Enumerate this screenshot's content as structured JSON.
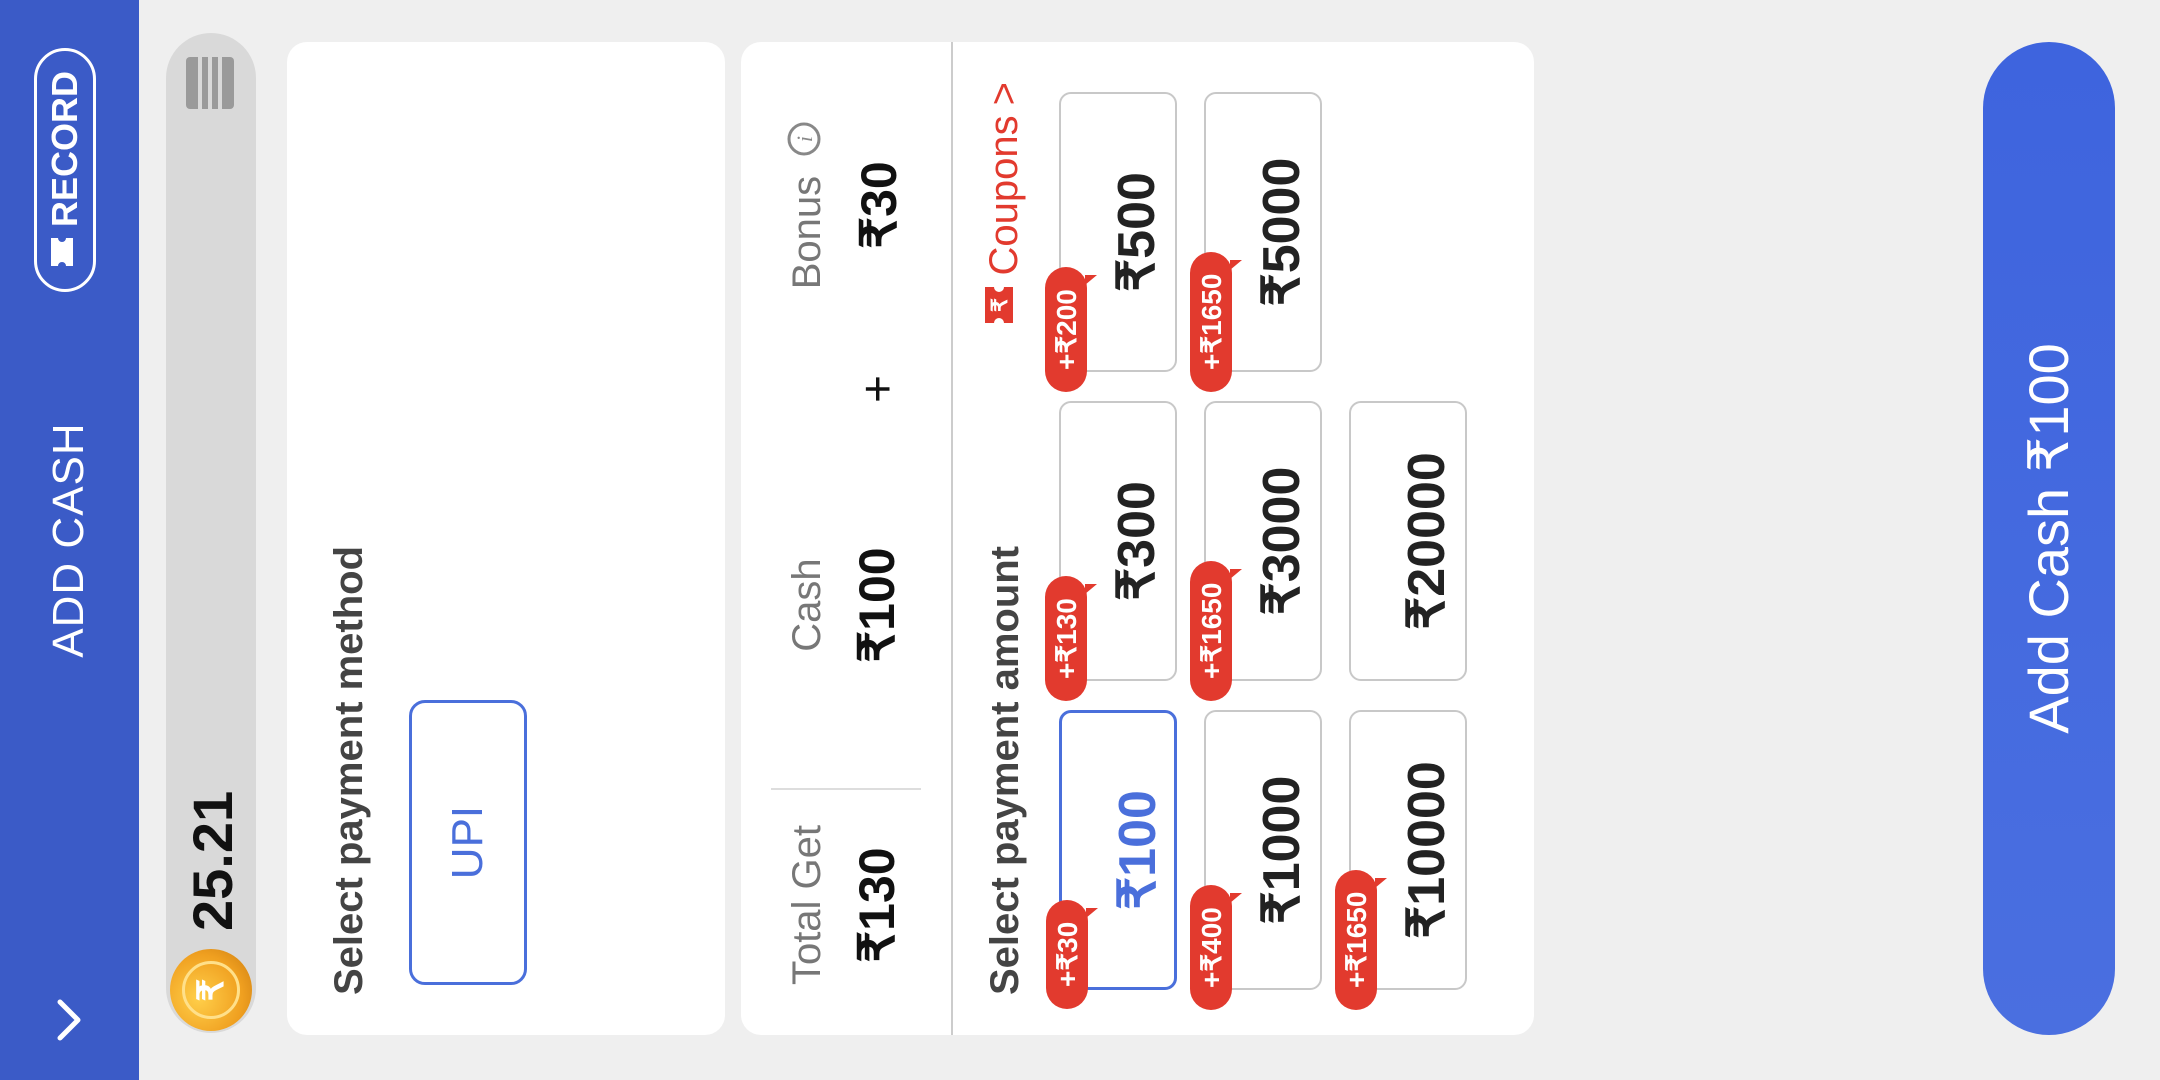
{
  "header": {
    "title": "ADD CASH",
    "record_label": "RECORD"
  },
  "balance": {
    "value": "25.21",
    "coin_symbol": "₹"
  },
  "payment_method": {
    "title": "Select payment method",
    "options": [
      "UPI"
    ],
    "selected": "UPI"
  },
  "summary": {
    "total_label": "Total Get",
    "total_value": "₹130",
    "cash_label": "Cash",
    "cash_value": "₹100",
    "plus_sign": "+",
    "bonus_label": "Bonus",
    "bonus_value": "₹30"
  },
  "amount": {
    "title": "Select payment amount",
    "coupons_label": "Coupons",
    "coupons_arrow": ">",
    "tiles": [
      {
        "amount": "₹100",
        "bonus": "+₹30",
        "selected": true
      },
      {
        "amount": "₹300",
        "bonus": "+₹130"
      },
      {
        "amount": "₹500",
        "bonus": "+₹200"
      },
      {
        "amount": "₹1000",
        "bonus": "+₹400"
      },
      {
        "amount": "₹3000",
        "bonus": "+₹1650"
      },
      {
        "amount": "₹5000",
        "bonus": "+₹1650"
      },
      {
        "amount": "₹10000",
        "bonus": "+₹1650"
      },
      {
        "amount": "₹20000",
        "bonus": ""
      }
    ]
  },
  "cta": {
    "label": "Add Cash ₹100"
  },
  "colors": {
    "header": "#3b5bc7",
    "accent": "#4a6fdb",
    "bonus_tag": "#e23a2e",
    "coupons": "#e23a2e"
  },
  "icons": [
    "chevron-down-icon",
    "ticket-icon",
    "coin-icon",
    "list-icon",
    "info-icon",
    "coupon-icon",
    "chevron-right-icon"
  ]
}
